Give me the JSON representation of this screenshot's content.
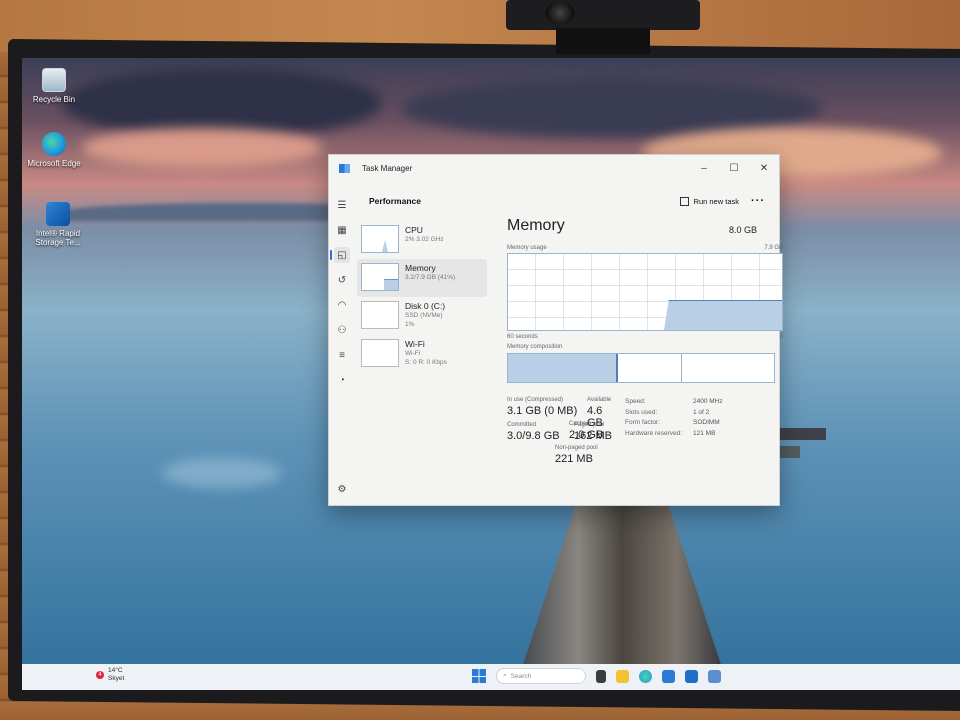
{
  "desktop": {
    "icons": [
      {
        "label": "Recycle Bin",
        "icon": "recycle-bin-icon"
      },
      {
        "label": "Microsoft Edge",
        "icon": "edge-icon"
      },
      {
        "label": "Intel® Rapid Storage Te...",
        "icon": "intel-rst-icon"
      }
    ]
  },
  "window": {
    "title": "Task Manager",
    "controls": {
      "minimize": "–",
      "maximize": "☐",
      "close": "✕"
    }
  },
  "header": {
    "section": "Performance",
    "run_new_task": "Run new task",
    "more": "···"
  },
  "sidebar_list": [
    {
      "name": "CPU",
      "sub1": "2% 3.02 GHz",
      "sub2": ""
    },
    {
      "name": "Memory",
      "sub1": "3.2/7.9 GB (41%)",
      "sub2": ""
    },
    {
      "name": "Disk 0 (C:)",
      "sub1": "SSD (NVMe)",
      "sub2": "1%"
    },
    {
      "name": "Wi-Fi",
      "sub1": "Wi-Fi",
      "sub2": "S: 0 R: 0 Kbps"
    }
  ],
  "memory": {
    "title": "Memory",
    "total": "8.0 GB",
    "usage_label": "Memory usage",
    "usage_max": "7.9 GB",
    "axis_left": "60 seconds",
    "axis_right": "0",
    "composition_label": "Memory composition",
    "in_use_fraction": 0.41,
    "stats": {
      "in_use_label": "In use (Compressed)",
      "in_use_value": "3.1 GB (0 MB)",
      "available_label": "Available",
      "available_value": "4.6 GB",
      "committed_label": "Committed",
      "committed_value": "3.0/9.8 GB",
      "cached_label": "Cached",
      "cached_value": "2.0 GB",
      "paged_label": "Paged pool",
      "paged_value": "162 MB",
      "nonpaged_label": "Non-paged pool",
      "nonpaged_value": "221 MB"
    },
    "props": [
      {
        "k": "Speed:",
        "v": "2400 MHz"
      },
      {
        "k": "Slots used:",
        "v": "1 of 2"
      },
      {
        "k": "Form factor:",
        "v": "SODIMM"
      },
      {
        "k": "Hardware reserved:",
        "v": "121 MB"
      }
    ]
  },
  "taskbar": {
    "weather_badge": "4",
    "weather_temp": "14°C",
    "weather_desc": "Skyet",
    "search_placeholder": "Search"
  },
  "colors": {
    "accent": "#2a6fd1",
    "graph_fill": "#b8cfe6",
    "graph_line": "#4f7fb5"
  }
}
